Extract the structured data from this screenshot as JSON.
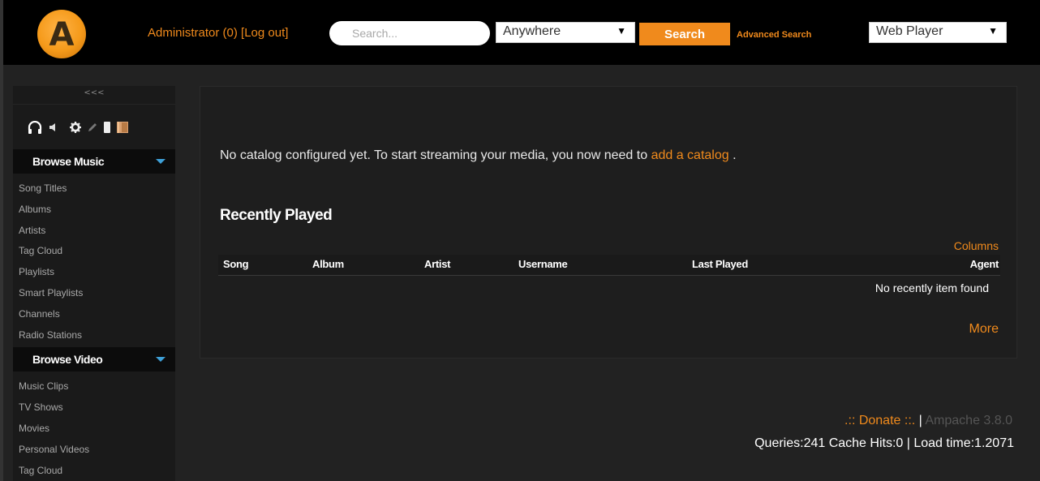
{
  "header": {
    "logo_letter": "A",
    "user_label": "Administrator (0)",
    "logout_label": "[Log out]",
    "search_placeholder": "Search...",
    "scope_value": "Anywhere",
    "search_button": "Search",
    "advanced_search": "Advanced Search",
    "player_value": "Web Player"
  },
  "sidebar": {
    "collapse_label": "<<<",
    "tool_icons": [
      "headphones-icon",
      "speaker-icon",
      "gear-icon",
      "pencil-icon",
      "phone-icon",
      "door-icon"
    ],
    "sections": [
      {
        "title": "Browse Music",
        "items": [
          "Song Titles",
          "Albums",
          "Artists",
          "Tag Cloud",
          "Playlists",
          "Smart Playlists",
          "Channels",
          "Radio Stations"
        ]
      },
      {
        "title": "Browse Video",
        "items": [
          "Music Clips",
          "TV Shows",
          "Movies",
          "Personal Videos",
          "Tag Cloud"
        ]
      }
    ]
  },
  "main": {
    "no_catalog_text": "No catalog configured yet. To start streaming your media, you now need to",
    "no_catalog_link": "add a catalog",
    "no_catalog_end": ".",
    "recent_title": "Recently Played",
    "columns_link": "Columns",
    "table_headers": [
      "Song",
      "Album",
      "Artist",
      "Username",
      "Last Played",
      "Agent"
    ],
    "empty_message": "No recently item found",
    "more_link": "More"
  },
  "footer": {
    "donate": ".:: Donate ::.",
    "separator": "|",
    "version": "Ampache 3.8.0",
    "stats": "Queries:241 Cache Hits:0 | Load time:1.2071"
  },
  "colors": {
    "accent": "#f08a1c",
    "background": "#222222",
    "header": "#000000",
    "section_triangle": "#3ea0d8"
  }
}
